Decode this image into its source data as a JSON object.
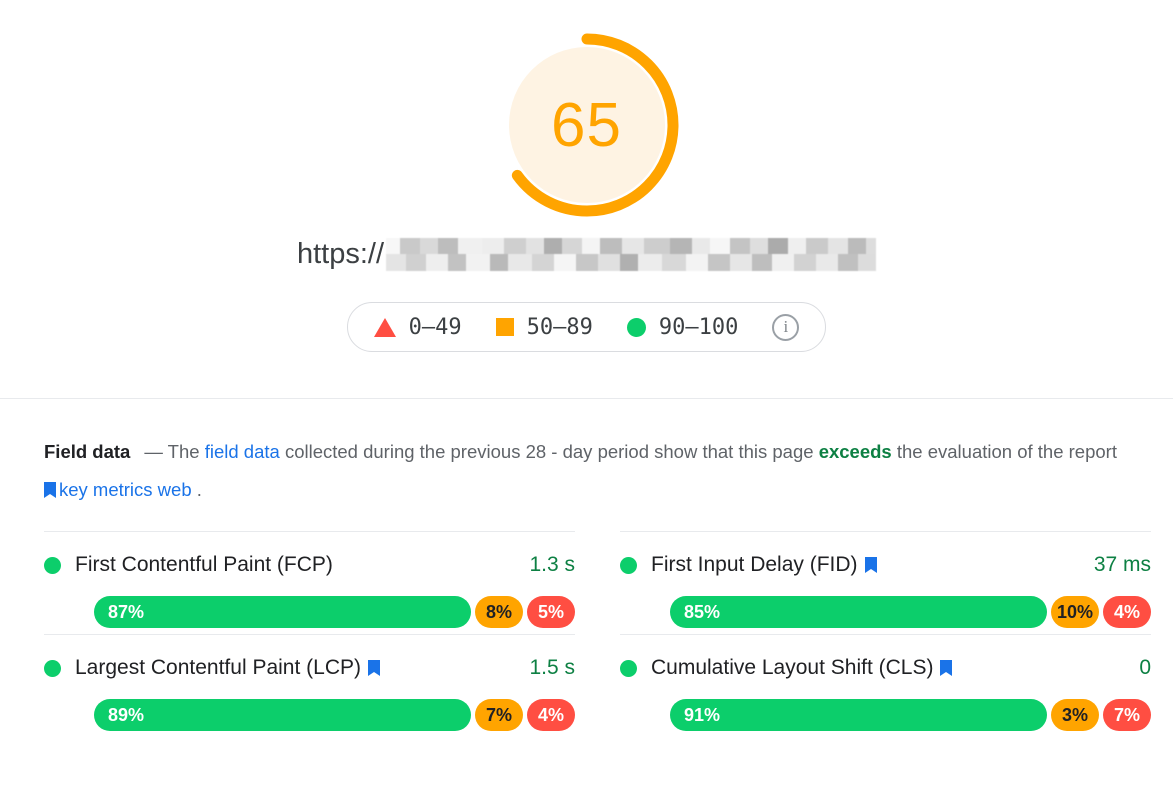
{
  "score": {
    "value": "65",
    "arc_percent": 65,
    "color": "#FFA400",
    "track_color": "#FEF3E3"
  },
  "url": {
    "protocol": "https://",
    "redacted": true
  },
  "legend": {
    "items": [
      {
        "icon": "triangle-icon",
        "label": "0–49",
        "color": "#FF4E42"
      },
      {
        "icon": "square-icon",
        "label": "50–89",
        "color": "#FFA400"
      },
      {
        "icon": "circle-icon",
        "label": "90–100",
        "color": "#0CCE6B"
      }
    ],
    "info_icon": "info-icon",
    "info_glyph": "i"
  },
  "field_data": {
    "title": "Field data",
    "dash": "—",
    "text_1": "The",
    "link_1": "field data",
    "text_2": "collected during the previous 28 - day period show that this page",
    "emphasis": "exceeds",
    "text_3": "the evaluation of the report",
    "link_2": "key metrics web",
    "text_4": "."
  },
  "metrics": [
    {
      "label": "First Contentful Paint (FCP)",
      "value": "1.3 s",
      "status": "good",
      "has_bookmark": false,
      "distribution": [
        {
          "label": "87%",
          "pct": 87,
          "bucket": "good"
        },
        {
          "label": "8%",
          "pct": 8,
          "bucket": "average"
        },
        {
          "label": "5%",
          "pct": 5,
          "bucket": "poor"
        }
      ]
    },
    {
      "label": "First Input Delay (FID)",
      "value": "37 ms",
      "status": "good",
      "has_bookmark": true,
      "distribution": [
        {
          "label": "85%",
          "pct": 85,
          "bucket": "good"
        },
        {
          "label": "10%",
          "pct": 10,
          "bucket": "average"
        },
        {
          "label": "4%",
          "pct": 4,
          "bucket": "poor"
        }
      ]
    },
    {
      "label": "Largest Contentful Paint (LCP)",
      "value": "1.5 s",
      "status": "good",
      "has_bookmark": true,
      "distribution": [
        {
          "label": "89%",
          "pct": 89,
          "bucket": "good"
        },
        {
          "label": "7%",
          "pct": 7,
          "bucket": "average"
        },
        {
          "label": "4%",
          "pct": 4,
          "bucket": "poor"
        }
      ]
    },
    {
      "label": "Cumulative Layout Shift (CLS)",
      "value": "0",
      "status": "good",
      "has_bookmark": true,
      "distribution": [
        {
          "label": "91%",
          "pct": 91,
          "bucket": "good"
        },
        {
          "label": "3%",
          "pct": 3,
          "bucket": "average"
        },
        {
          "label": "7%",
          "pct": 7,
          "bucket": "poor"
        }
      ]
    }
  ],
  "colors": {
    "good": "#0CCE6B",
    "average": "#FFA400",
    "poor": "#FF4E42",
    "link": "#1A73E8",
    "good_text": "#0D8043"
  }
}
